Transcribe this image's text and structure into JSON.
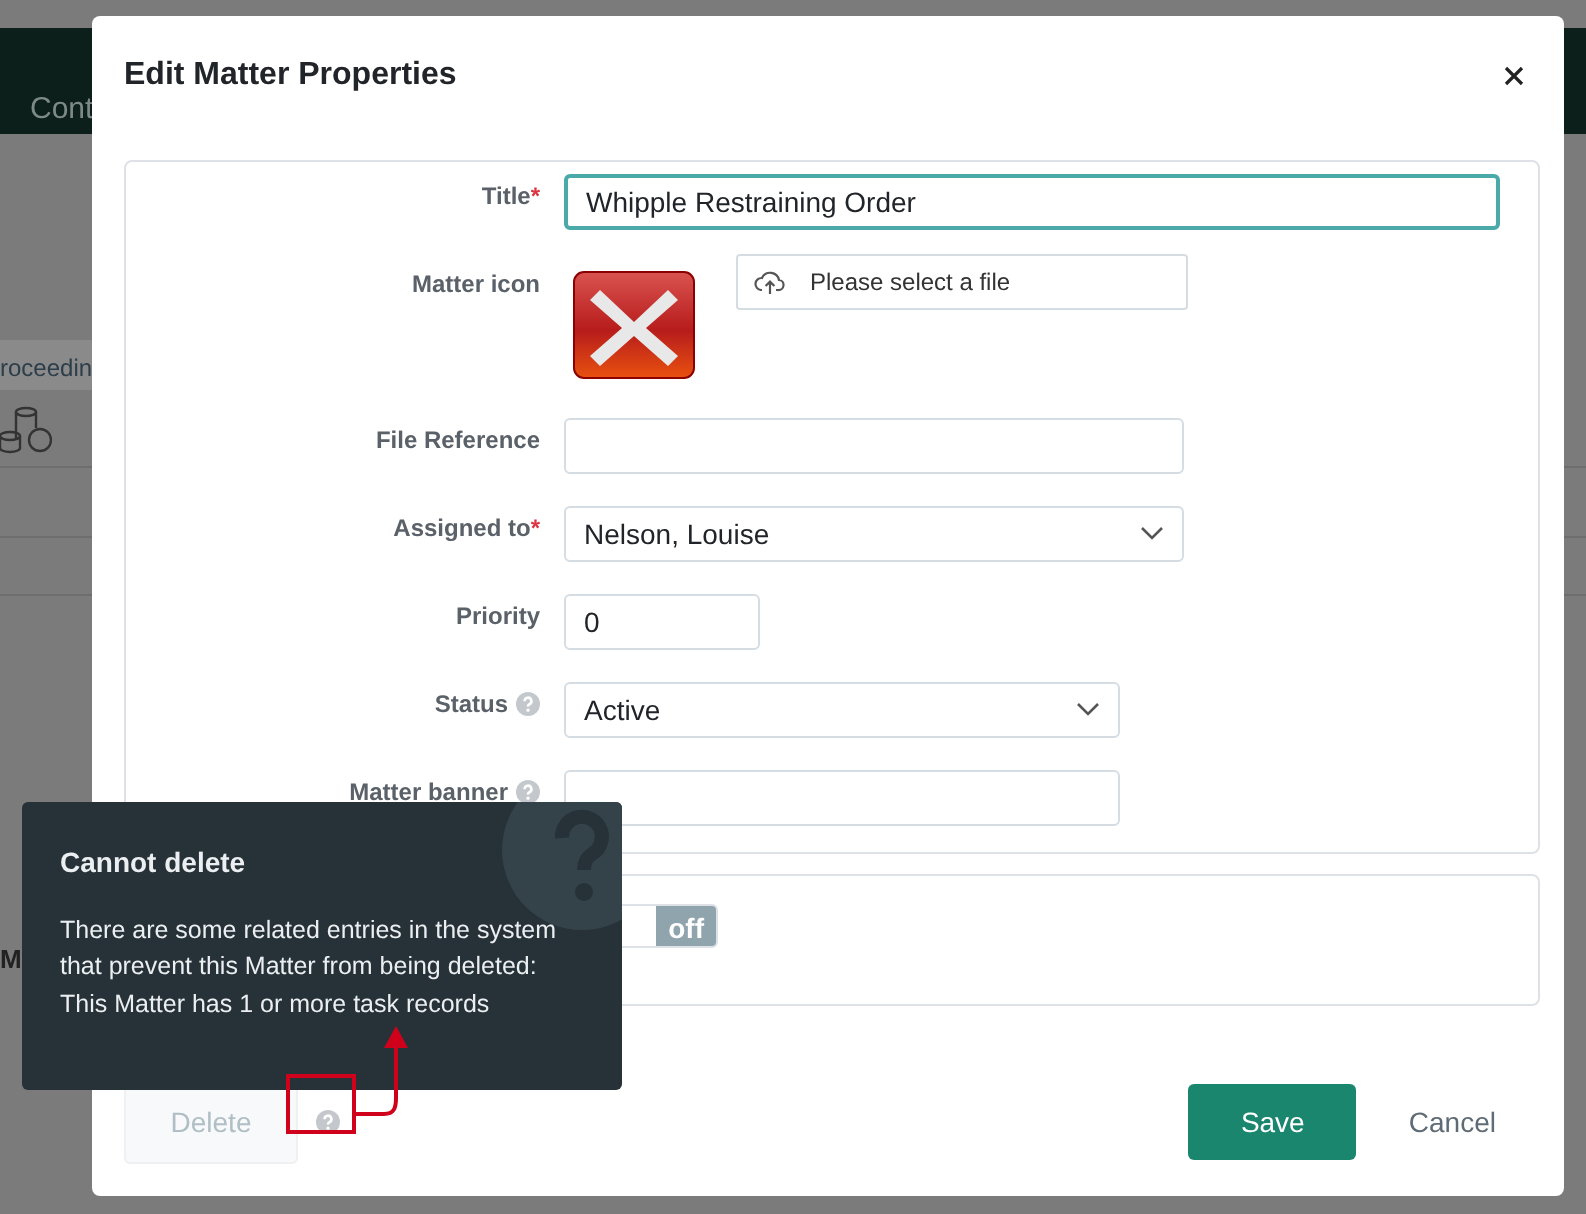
{
  "background": {
    "nav_text": "Cont",
    "tab_text": "roceedin",
    "section_text": "M"
  },
  "modal": {
    "title": "Edit Matter Properties",
    "fields": [
      {
        "kind": "text",
        "label": "Title",
        "required_mark": "*",
        "help": false,
        "value": "Whipple Restraining Order",
        "focused": true
      },
      {
        "kind": "file",
        "label": "Matter icon",
        "help": false,
        "button": "Please select a file"
      },
      {
        "kind": "text",
        "label": "File Reference",
        "help": false,
        "focused": false
      },
      {
        "kind": "select",
        "label": "Assigned to",
        "required_mark": "*",
        "help": false,
        "value": "Nelson, Louise"
      },
      {
        "kind": "number",
        "label": "Priority",
        "help": false,
        "value": "0"
      },
      {
        "kind": "select",
        "label": "Status",
        "help": true,
        "value": "Active"
      },
      {
        "kind": "text",
        "label": "Matter banner",
        "help": true,
        "focused": false
      }
    ],
    "toggle": {
      "off_label": "off",
      "on": false
    },
    "buttons": {
      "delete": {
        "label": "Delete",
        "disabled": true
      },
      "save": "Save",
      "cancel": "Cancel"
    }
  },
  "tooltip": {
    "title": "Cannot delete",
    "body": "There are some related entries in the system that prevent this Matter from being deleted: This Matter has 1 or more task records"
  }
}
